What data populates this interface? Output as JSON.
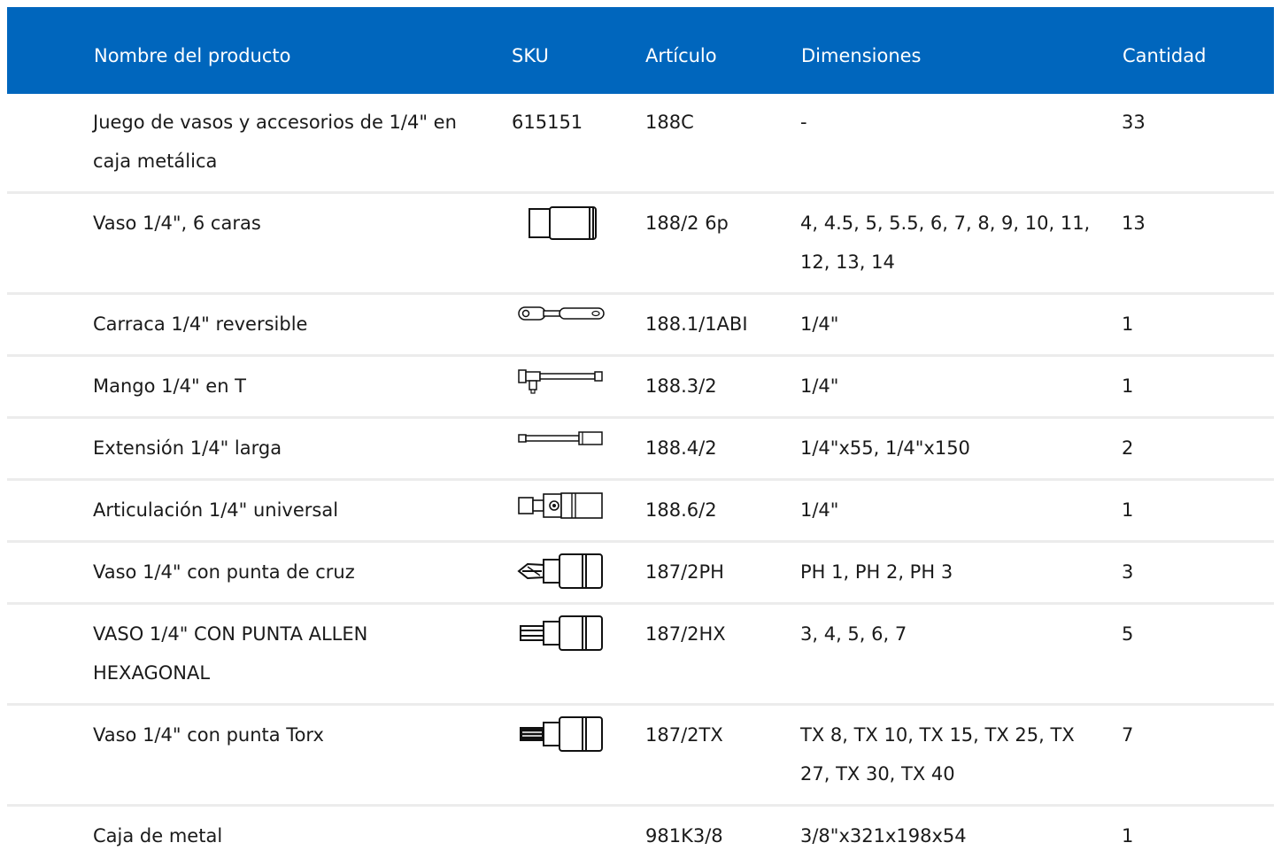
{
  "columns": {
    "name": "Nombre del producto",
    "sku": "SKU",
    "article": "Artículo",
    "dimensions": "Dimensiones",
    "quantity": "Cantidad"
  },
  "rows": [
    {
      "name": "Juego de vasos y accesorios de 1/4\" en caja metálica",
      "sku": "615151",
      "article": "188C",
      "dimensions": "-",
      "quantity": "33"
    },
    {
      "name": "Vaso 1/4\", 6 caras",
      "sku_icon": "socket-icon",
      "article": "188/2 6p",
      "dimensions": "4, 4.5, 5, 5.5, 6, 7, 8, 9, 10, 11, 12, 13, 14",
      "quantity": "13"
    },
    {
      "name": "Carraca 1/4\" reversible",
      "sku_icon": "ratchet-icon",
      "article": "188.1/1ABI",
      "dimensions": "1/4\"",
      "quantity": "1"
    },
    {
      "name": "Mango 1/4\" en T",
      "sku_icon": "t-handle-icon",
      "article": "188.3/2",
      "dimensions": "1/4\"",
      "quantity": "1"
    },
    {
      "name": "Extensión 1/4\" larga",
      "sku_icon": "extension-bar-icon",
      "article": "188.4/2",
      "dimensions": "1/4\"x55, 1/4\"x150",
      "quantity": "2"
    },
    {
      "name": "Articulación 1/4\" universal",
      "sku_icon": "universal-joint-icon",
      "article": "188.6/2",
      "dimensions": "1/4\"",
      "quantity": "1"
    },
    {
      "name": "Vaso 1/4\" con punta de cruz",
      "sku_icon": "phillips-bit-socket-icon",
      "article": "187/2PH",
      "dimensions": "PH 1, PH 2, PH 3",
      "quantity": "3"
    },
    {
      "name": "VASO 1/4\" CON PUNTA ALLEN HEXAGONAL",
      "sku_icon": "hex-bit-socket-icon",
      "article": "187/2HX",
      "dimensions": "3, 4, 5, 6, 7",
      "quantity": "5"
    },
    {
      "name": "Vaso 1/4\" con punta Torx",
      "sku_icon": "torx-bit-socket-icon",
      "article": "187/2TX",
      "dimensions": "TX 8, TX 10, TX 15, TX 25, TX 27, TX 30, TX 40",
      "quantity": "7"
    },
    {
      "name": "Caja de metal",
      "sku": "",
      "article": "981K3/8",
      "dimensions": "3/8\"x321x198x54",
      "quantity": "1"
    }
  ]
}
